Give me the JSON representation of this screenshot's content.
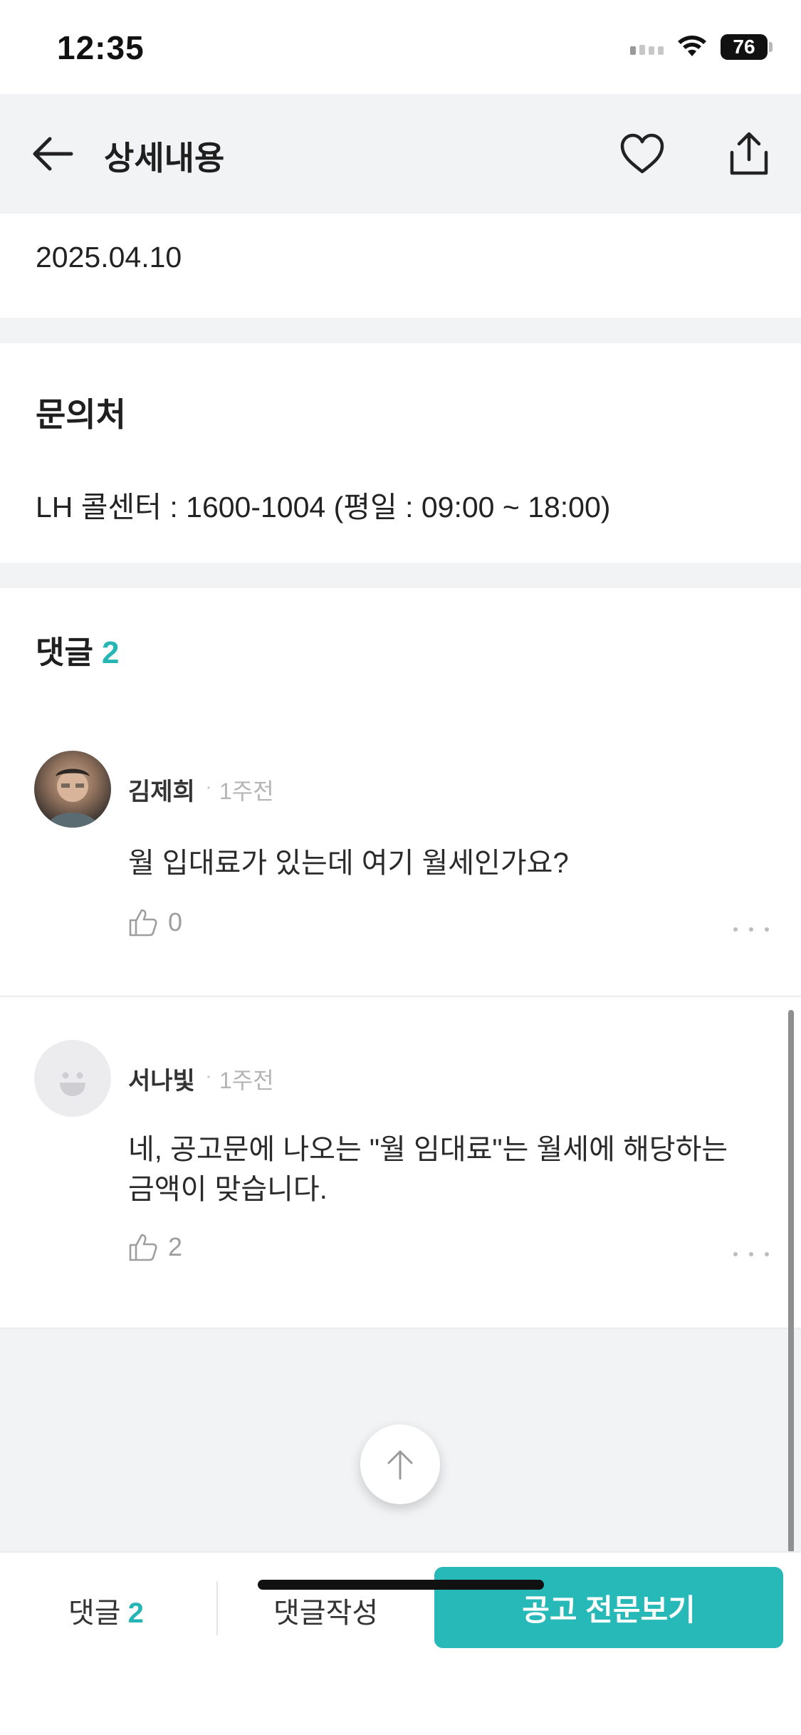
{
  "status_bar": {
    "time": "12:35",
    "battery": "76"
  },
  "header": {
    "title": "상세내용"
  },
  "date": "2025.04.10",
  "contact": {
    "title": "문의처",
    "text": "LH 콜센터 : 1600-1004 (평일 : 09:00 ~ 18:00)"
  },
  "comments": {
    "title": "댓글",
    "count": "2",
    "items": [
      {
        "author": "김제희",
        "time": "1주전",
        "text": "월 입대료가 있는데 여기 월세인가요?",
        "likes": "0"
      },
      {
        "author": "서나빛",
        "time": "1주전",
        "text": " 네, 공고문에 나오는 \"월 임대료\"는 월세에 해당하는 금액이 맞습니다.",
        "likes": "2"
      }
    ]
  },
  "bottom_bar": {
    "comments_label": "댓글",
    "comments_count": "2",
    "write_label": "댓글작성",
    "cta_label": "공고 전문보기"
  },
  "colors": {
    "accent": "#27b8b8",
    "section_bg": "#f2f3f5"
  }
}
